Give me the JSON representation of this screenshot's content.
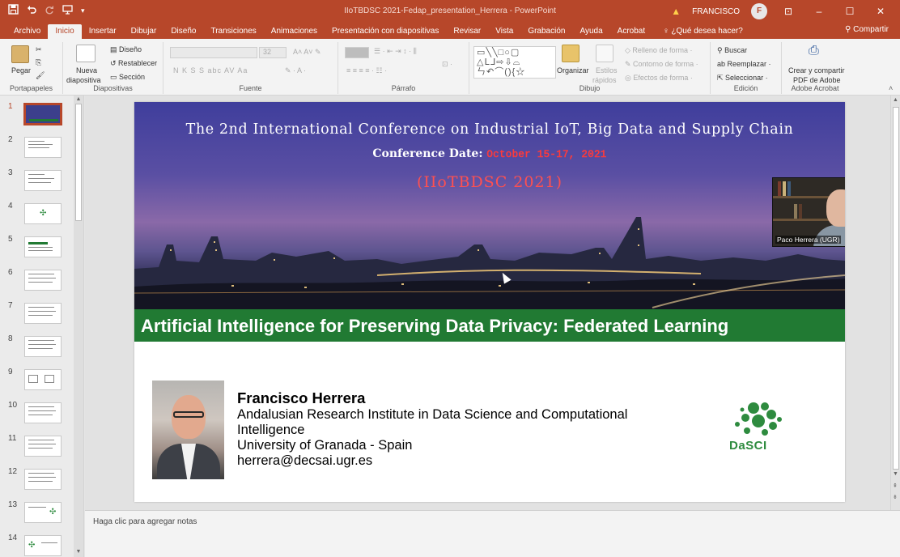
{
  "window": {
    "title": "IIoTBDSC 2021-Fedap_presentation_Herrera - PowerPoint",
    "user": "FRANCISCO",
    "user_initial": "F",
    "qat": [
      "save-icon",
      "undo-icon",
      "redo-icon",
      "presenter-icon",
      "customize-icon"
    ],
    "controls": [
      "ribbon-display-icon",
      "minimize-icon",
      "maximize-icon",
      "close-icon"
    ]
  },
  "tabs": [
    "Archivo",
    "Inicio",
    "Insertar",
    "Dibujar",
    "Diseño",
    "Transiciones",
    "Animaciones",
    "Presentación con diapositivas",
    "Revisar",
    "Vista",
    "Grabación",
    "Ayuda",
    "Acrobat"
  ],
  "active_tab": "Inicio",
  "tell_me": "¿Qué desea hacer?",
  "share": "Compartir",
  "ribbon": {
    "clipboard": {
      "label": "Portapapeles",
      "paste": "Pegar"
    },
    "slides": {
      "label": "Diapositivas",
      "new_slide_1": "Nueva",
      "new_slide_2": "diapositiva",
      "layout": "Diseño",
      "reset": "Restablecer",
      "section": "Sección"
    },
    "font": {
      "label": "Fuente",
      "font_size": "32",
      "buttons": "N  K  S  S  abc  AV  Aa"
    },
    "paragraph": {
      "label": "Párrafo"
    },
    "drawing": {
      "label": "Dibujo",
      "arrange": "Organizar",
      "quick_styles_1": "Estilos",
      "quick_styles_2": "rápidos",
      "fill": "Relleno de forma",
      "outline": "Contorno de forma",
      "effects": "Efectos de forma"
    },
    "editing": {
      "label": "Edición",
      "find": "Buscar",
      "replace": "Reemplazar",
      "select": "Seleccionar"
    },
    "acrobat": {
      "label": "Adobe Acrobat",
      "create_1": "Crear y compartir",
      "create_2": "PDF de Adobe"
    }
  },
  "thumbnails": [
    1,
    2,
    3,
    4,
    5,
    6,
    7,
    8,
    9,
    10,
    11,
    12,
    13,
    14
  ],
  "selected_thumbnail": 1,
  "slide": {
    "conf_title": "The 2nd International Conference on Industrial IoT, Big Data and Supply Chain",
    "conf_date_label": "Conference Date: ",
    "conf_date_value": "October 15-17, 2021",
    "conf_abbr": "(IIoTBDSC 2021)",
    "talk_title": "Artificial Intelligence for Preserving Data Privacy: Federated Learning",
    "speaker_name": "Francisco Herrera",
    "affiliation": "Andalusian Research Institute in Data Science and Computational Intelligence",
    "university": "University of Granada - Spain",
    "email": "herrera@decsai.ugr.es",
    "logo_text": "DaSCI"
  },
  "webcam_label": "Paco Herrera (UGR)",
  "notes_placeholder": "Haga clic para agregar notas",
  "colors": {
    "accent": "#b7472a",
    "green_band": "#217a33",
    "date_red": "#ff3b3b",
    "logo_green": "#2e8b3f"
  }
}
